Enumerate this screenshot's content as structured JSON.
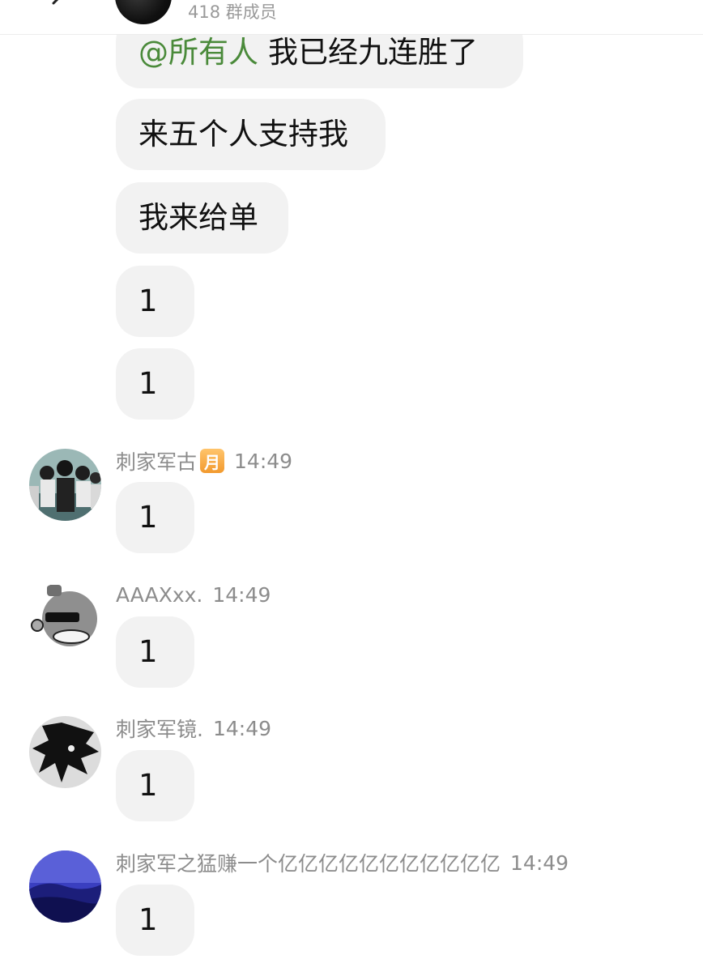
{
  "header": {
    "member_count": "418 群成员"
  },
  "messages": {
    "m1": {
      "mention": "@所有人",
      "text": "我已经九连胜了"
    },
    "m2": {
      "text": "来五个人支持我"
    },
    "m3": {
      "text": "我来给单"
    },
    "m4": {
      "text": "1"
    },
    "m5": {
      "text": "1"
    },
    "m6": {
      "sender": "刺家军古",
      "badge": "月",
      "time": "14:49",
      "text": "1"
    },
    "m7": {
      "sender": "AAAXxx.",
      "time": "14:49",
      "text": "1"
    },
    "m8": {
      "sender": "刺家军镜.",
      "time": "14:49",
      "text": "1"
    },
    "m9": {
      "sender": "刺家军之猛赚一个亿亿亿亿亿亿亿亿亿亿亿",
      "time": "14:49",
      "text": "1"
    }
  },
  "colors": {
    "bubble": "#f2f2f2",
    "mention": "#4a8a3a",
    "meta_text": "#8c8c8c",
    "badge": "#f29a2e"
  },
  "icons": {
    "back": "chevron-left-icon",
    "badge": "month-badge-icon"
  }
}
